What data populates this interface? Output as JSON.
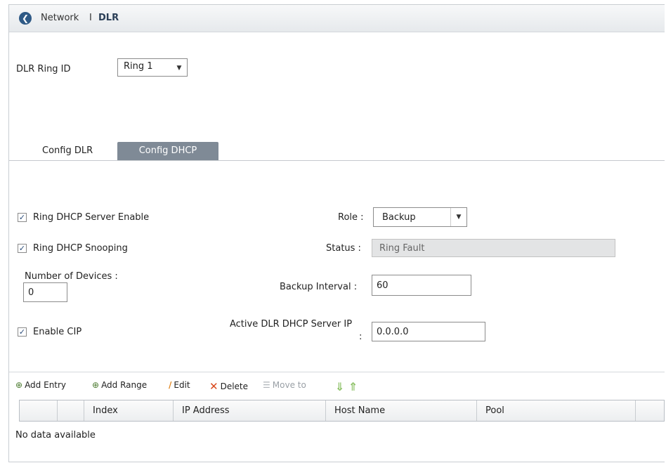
{
  "header": {
    "back_glyph": "❮",
    "section": "Network",
    "separator": "I",
    "page": "DLR"
  },
  "ring": {
    "label": "DLR Ring ID",
    "value": "Ring 1"
  },
  "tabs": [
    {
      "label": "Config DLR",
      "active": false
    },
    {
      "label": "Config DHCP",
      "active": true
    }
  ],
  "form": {
    "server_enable": {
      "label": "Ring DHCP Server Enable",
      "checked": true
    },
    "snooping": {
      "label": "Ring DHCP Snooping",
      "checked": true
    },
    "devices": {
      "label": "Number of Devices :",
      "value": "0"
    },
    "enable_cip": {
      "label": "Enable CIP",
      "checked": true
    },
    "role": {
      "label": "Role :",
      "value": "Backup"
    },
    "status": {
      "label": "Status :",
      "value": "Ring Fault"
    },
    "backup_interval": {
      "label": "Backup Interval :",
      "value": "60"
    },
    "active_ip": {
      "label_line1": "Active DLR DHCP Server IP",
      "label_line2": ":",
      "value": "0.0.0.0"
    }
  },
  "toolbar": {
    "add_entry": "Add Entry",
    "add_range": "Add Range",
    "edit": "Edit",
    "delete": "Delete",
    "move_to": "Move to"
  },
  "table": {
    "columns": [
      "",
      "",
      "Index",
      "IP Address",
      "Host Name",
      "Pool",
      ""
    ],
    "empty": "No data available"
  },
  "colors": {
    "accent": "#2f5a86",
    "tab_active": "#7f8a96",
    "delete": "#d9481c",
    "edit": "#e0851e",
    "arrows": "#8fc26a"
  }
}
